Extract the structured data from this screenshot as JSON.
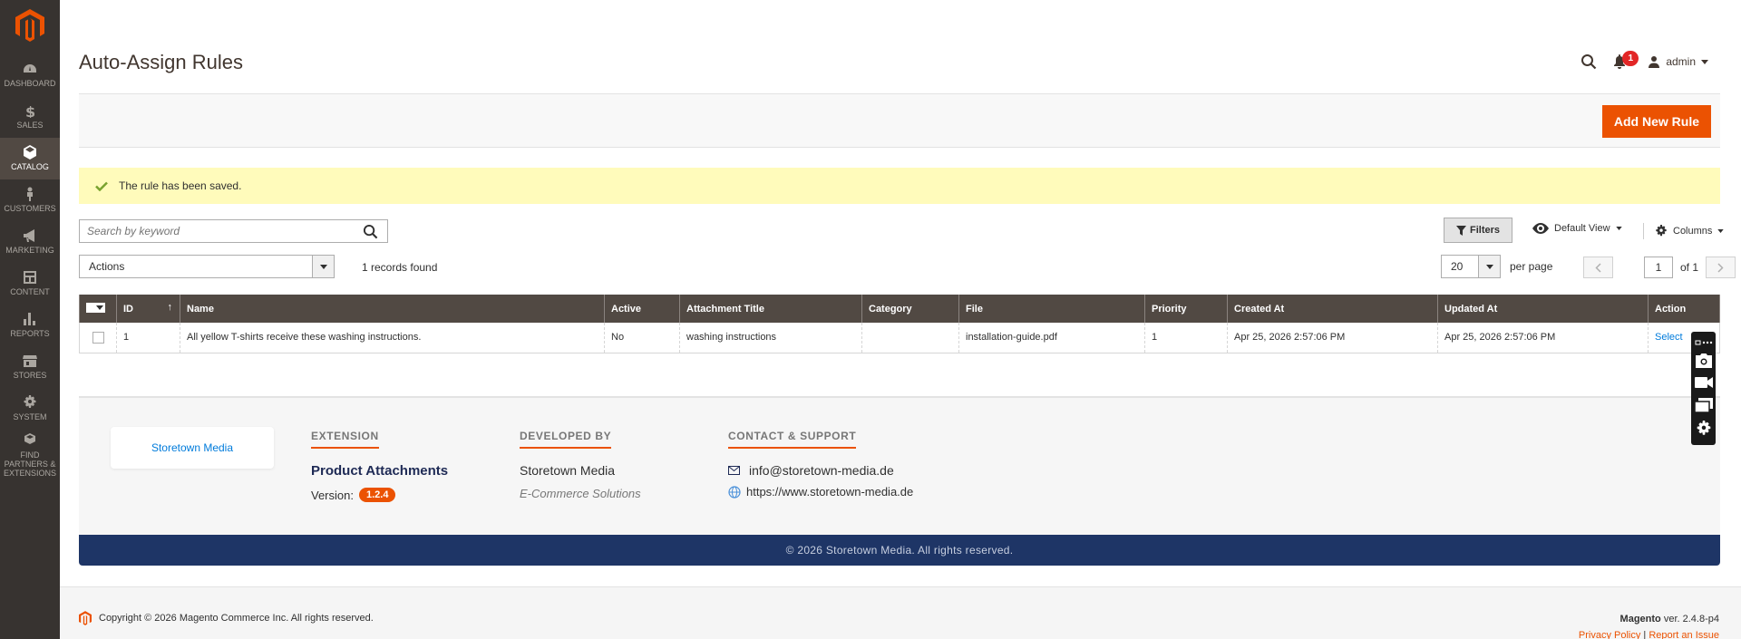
{
  "sidebar": {
    "items": [
      {
        "label": "DASHBOARD",
        "icon": "dashboard-icon"
      },
      {
        "label": "SALES",
        "icon": "dollar-icon"
      },
      {
        "label": "CATALOG",
        "icon": "cube-icon"
      },
      {
        "label": "CUSTOMERS",
        "icon": "person-icon"
      },
      {
        "label": "MARKETING",
        "icon": "megaphone-icon"
      },
      {
        "label": "CONTENT",
        "icon": "layout-icon"
      },
      {
        "label": "REPORTS",
        "icon": "bar-chart-icon"
      },
      {
        "label": "STORES",
        "icon": "store-icon"
      },
      {
        "label": "SYSTEM",
        "icon": "gear-icon"
      },
      {
        "label": "FIND PARTNERS & EXTENSIONS",
        "icon": "boxes-icon"
      }
    ],
    "active": "CATALOG"
  },
  "header": {
    "title": "Auto-Assign Rules",
    "notifications_count": "1",
    "user": "admin"
  },
  "toolbar": {
    "add_new_label": "Add New Rule"
  },
  "message": {
    "text": "The rule has been saved."
  },
  "grid_controls": {
    "search_placeholder": "Search by keyword",
    "filters_label": "Filters",
    "view_label": "Default View",
    "columns_label": "Columns",
    "actions_label": "Actions",
    "records_found": "1 records found",
    "per_page_value": "20",
    "per_page_label": "per page",
    "page_value": "1",
    "page_of": "of 1"
  },
  "grid": {
    "columns": [
      "ID",
      "Name",
      "Active",
      "Attachment Title",
      "Category",
      "File",
      "Priority",
      "Created At",
      "Updated At",
      "Action"
    ],
    "rows": [
      {
        "id": "1",
        "name": "All yellow T-shirts receive these washing instructions.",
        "active": "No",
        "attachment_title": "washing instructions",
        "category": "",
        "file": "installation-guide.pdf",
        "priority": "1",
        "created_at": "Apr 25, 2026 2:57:06 PM",
        "updated_at": "Apr 25, 2026 2:57:06 PM",
        "action": "Select"
      }
    ]
  },
  "extension_footer": {
    "brand": "Storetown Media",
    "extension_heading": "EXTENSION",
    "extension_name": "Product Attachments",
    "version_label": "Version:",
    "version": "1.2.4",
    "developed_heading": "DEVELOPED BY",
    "developer": "Storetown Media",
    "developer_tagline": "E-Commerce Solutions",
    "contact_heading": "CONTACT & SUPPORT",
    "email": "info@storetown-media.de",
    "website": "https://www.storetown-media.de",
    "copyright": "© 2026 Storetown Media. All rights reserved."
  },
  "page_footer": {
    "copyright": "Copyright © 2026 Magento Commerce Inc. All rights reserved.",
    "product": "Magento",
    "version": " ver. 2.4.8-p4",
    "privacy": "Privacy Policy",
    "separator": "|",
    "report": "Report an Issue"
  },
  "colors": {
    "accent": "#eb5202",
    "sidebar": "#373330",
    "grid_header": "#514943",
    "message_bg": "#fffbbb",
    "footer_bar": "#1e3566"
  }
}
